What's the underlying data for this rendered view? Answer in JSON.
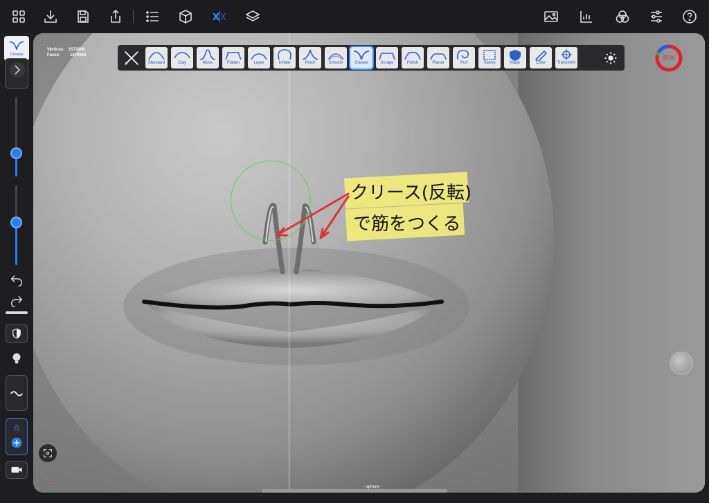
{
  "stats": {
    "vertices_label": "Vertices:",
    "vertices_value": "1572866",
    "faces_label": "Faces:",
    "faces_value": "1572864"
  },
  "brushes": [
    {
      "label": "Standard",
      "selected": false
    },
    {
      "label": "Clay",
      "selected": false
    },
    {
      "label": "Move",
      "selected": false
    },
    {
      "label": "Flatten",
      "selected": false
    },
    {
      "label": "Layer",
      "selected": false
    },
    {
      "label": "Inflate",
      "selected": false
    },
    {
      "label": "Pinch",
      "selected": false
    },
    {
      "label": "Smooth",
      "selected": false
    },
    {
      "label": "Crease",
      "selected": true
    },
    {
      "label": "Scrape",
      "selected": false
    },
    {
      "label": "Polish",
      "selected": false
    },
    {
      "label": "Planar",
      "selected": false
    },
    {
      "label": "Pull",
      "selected": false
    },
    {
      "label": "Stamp",
      "selected": false
    },
    {
      "label": "Mask",
      "selected": false
    },
    {
      "label": "Color",
      "selected": false
    },
    {
      "label": "Transform",
      "selected": false
    }
  ],
  "current_tool": "Crease",
  "memory_ring_label": "81%",
  "annotation": {
    "line1": "クリース(反転)",
    "line2": "で筋をつくる"
  },
  "object_name": "- sphere -",
  "colors": {
    "accent": "#2a7ef0",
    "annotation_bg": "#f3ec7a",
    "arrow": "#e0303a",
    "cursor": "#5fcf5f"
  }
}
